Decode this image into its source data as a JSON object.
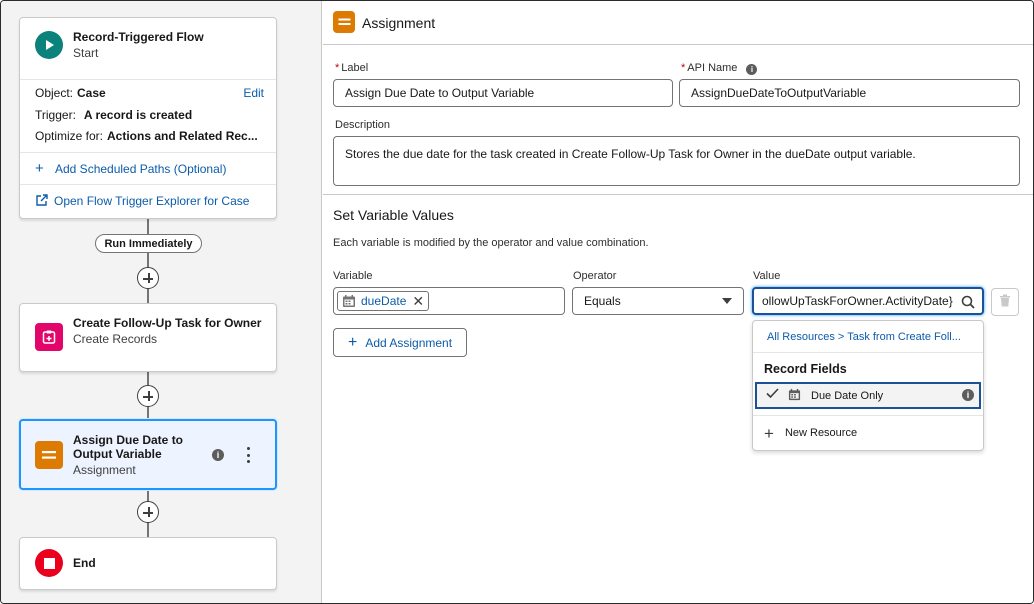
{
  "canvas": {
    "start_node": {
      "title": "Record-Triggered Flow",
      "subtitle": "Start",
      "object_label": "Object:",
      "object_value": "Case",
      "edit_label": "Edit",
      "trigger_label": "Trigger:",
      "trigger_value": "A record is created",
      "optimize_label": "Optimize for:",
      "optimize_value": "Actions and Related Rec...",
      "scheduled_paths_link": "Add Scheduled Paths (Optional)",
      "explorer_link": "Open Flow Trigger Explorer for Case"
    },
    "path_pill": "Run Immediately",
    "task_node": {
      "title": "Create Follow-Up Task for Owner",
      "subtitle": "Create Records"
    },
    "assign_node": {
      "title": "Assign Due Date to Output Variable",
      "subtitle": "Assignment"
    },
    "end_node": {
      "title": "End"
    }
  },
  "panel": {
    "title": "Assignment",
    "label_field": {
      "label": "Label",
      "value": "Assign Due Date to Output Variable"
    },
    "api_name_field": {
      "label": "API Name",
      "value": "AssignDueDateToOutputVariable"
    },
    "description_field": {
      "label": "Description",
      "value": "Stores the due date for the task created in Create Follow-Up Task for Owner in the dueDate output variable."
    },
    "section_title": "Set Variable Values",
    "section_desc": "Each variable is modified by the operator and value combination.",
    "row": {
      "variable_label": "Variable",
      "variable_pill": "dueDate",
      "operator_label": "Operator",
      "operator_value": "Equals",
      "value_label": "Value",
      "value_text": "ollowUpTaskForOwner.ActivityDate}"
    },
    "add_assignment_button": "Add Assignment",
    "dropdown": {
      "breadcrumb": "All Resources > Task from Create Foll...",
      "heading": "Record Fields",
      "selected_item": "Due Date Only",
      "new_resource": "New Resource"
    }
  },
  "colors": {
    "start_icon": "#0b827c",
    "task_icon": "#e3066a",
    "assign_icon": "#dd7a01",
    "end_icon": "#ea001e",
    "link": "#0b5cab",
    "selection": "#1b96ff"
  }
}
